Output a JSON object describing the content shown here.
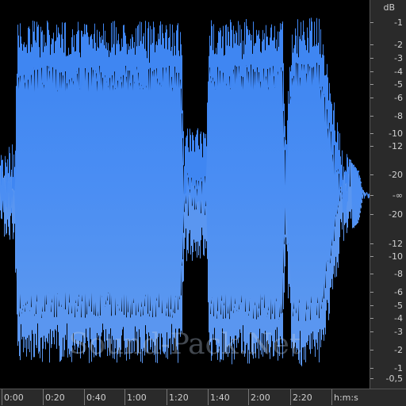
{
  "watermark": "Sound-Pack.Net",
  "colors": {
    "waveform_top": "#3f86f2",
    "waveform_bottom": "#5a96f0",
    "background": "#000000",
    "ruler_bg": "#2a2a2a",
    "ruler_text": "#cfcfcf"
  },
  "db_scale": {
    "unit": "dB",
    "upper_labels": [
      "-1",
      "-2",
      "-3",
      "-4",
      "-5",
      "-6",
      "-8",
      "-10",
      "-12",
      "-20"
    ],
    "center_label": "-∞",
    "lower_labels": [
      "-20",
      "-12",
      "-10",
      "-8",
      "-6",
      "-5",
      "-4",
      "-3",
      "-2",
      "-1",
      "-0,5"
    ]
  },
  "time_ruler": {
    "labels": [
      "0:00",
      "0:20",
      "0:40",
      "1:00",
      "1:20",
      "1:40",
      "2:00",
      "2:20"
    ],
    "units": "h:m:s"
  }
}
